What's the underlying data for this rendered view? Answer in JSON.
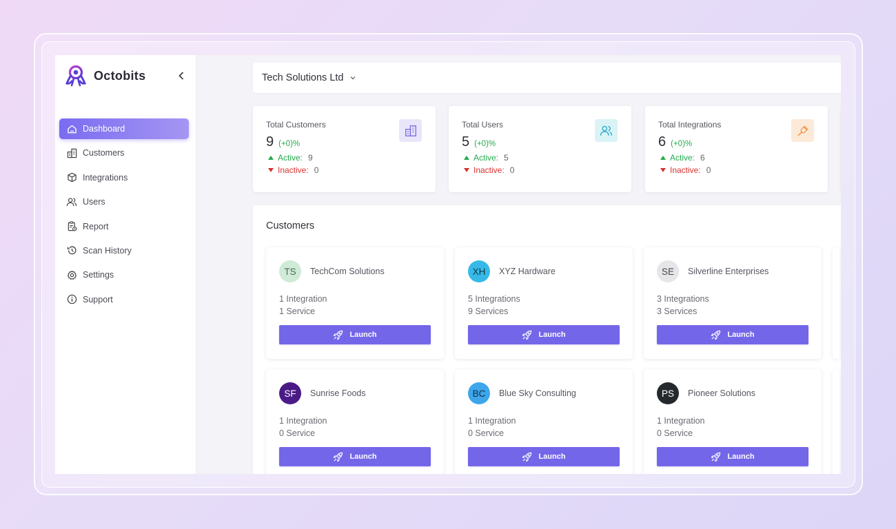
{
  "brand": {
    "name": "Octobits"
  },
  "sidebar": {
    "items": [
      {
        "label": "Dashboard",
        "icon": "home-icon",
        "active": true
      },
      {
        "label": "Customers",
        "icon": "building-icon",
        "active": false
      },
      {
        "label": "Integrations",
        "icon": "cube-icon",
        "active": false
      },
      {
        "label": "Users",
        "icon": "users-icon",
        "active": false
      },
      {
        "label": "Report",
        "icon": "report-icon",
        "active": false
      },
      {
        "label": "Scan History",
        "icon": "history-icon",
        "active": false
      },
      {
        "label": "Settings",
        "icon": "gear-icon",
        "active": false
      },
      {
        "label": "Support",
        "icon": "info-icon",
        "active": false
      }
    ]
  },
  "org": {
    "name": "Tech Solutions Ltd"
  },
  "stats": [
    {
      "title": "Total Customers",
      "value": "9",
      "change": "(+0)%",
      "active_label": "Active:",
      "active": "9",
      "inactive_label": "Inactive:",
      "inactive": "0",
      "icon": "building-icon",
      "icon_bg": "#e9e6fb",
      "icon_color": "#7b6ee0"
    },
    {
      "title": "Total Users",
      "value": "5",
      "change": "(+0)%",
      "active_label": "Active:",
      "active": "5",
      "inactive_label": "Inactive:",
      "inactive": "0",
      "icon": "users-icon",
      "icon_bg": "#daf3f7",
      "icon_color": "#2aa9c4"
    },
    {
      "title": "Total Integrations",
      "value": "6",
      "change": "(+0)%",
      "active_label": "Active:",
      "active": "6",
      "inactive_label": "Inactive:",
      "inactive": "0",
      "icon": "plug-icon",
      "icon_bg": "#fde9d8",
      "icon_color": "#ef9650"
    }
  ],
  "customers": {
    "title": "Customers",
    "launch_label": "Launch",
    "items": [
      {
        "initials": "TS",
        "name": "TechCom Solutions",
        "integrations": "1 Integration",
        "services": "1 Service",
        "avatar_bg": "#cfead6",
        "avatar_fg": "#4b6b55"
      },
      {
        "initials": "XH",
        "name": "XYZ Hardware",
        "integrations": "5 Integrations",
        "services": "9 Services",
        "avatar_bg": "#36b9e6",
        "avatar_fg": "#10384a"
      },
      {
        "initials": "SE",
        "name": "Silverline Enterprises",
        "integrations": "3 Integrations",
        "services": "3 Services",
        "avatar_bg": "#e6e6e9",
        "avatar_fg": "#45454e"
      },
      {
        "initials": "SF",
        "name": "Sunrise Foods",
        "integrations": "1 Integration",
        "services": "0 Service",
        "avatar_bg": "#4a1a86",
        "avatar_fg": "#ffffff"
      },
      {
        "initials": "BC",
        "name": "Blue Sky Consulting",
        "integrations": "1 Integration",
        "services": "0 Service",
        "avatar_bg": "#3ea6ea",
        "avatar_fg": "#0f2d48"
      },
      {
        "initials": "PS",
        "name": "Pioneer Solutions",
        "integrations": "1 Integration",
        "services": "0 Service",
        "avatar_bg": "#25292d",
        "avatar_fg": "#ffffff"
      }
    ]
  },
  "colors": {
    "accent": "#7466e8",
    "positive": "#22a94b",
    "negative": "#d8312f"
  }
}
